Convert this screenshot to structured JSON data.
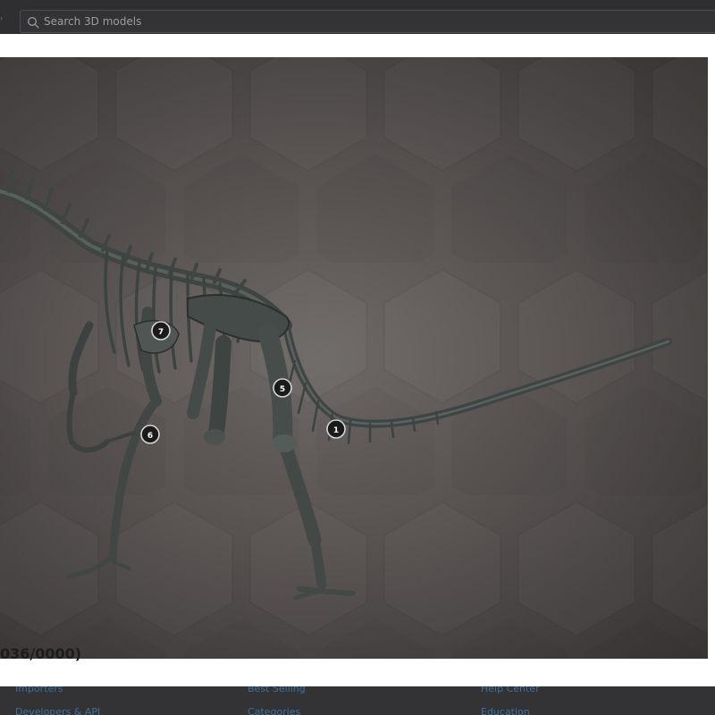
{
  "header": {
    "search": {
      "placeholder": "Search 3D models",
      "value": ""
    }
  },
  "viewer": {
    "hotspots": [
      {
        "label": "7"
      },
      {
        "label": "5"
      },
      {
        "label": "6"
      },
      {
        "label": "1"
      }
    ]
  },
  "caption": "036/0000)",
  "footer": {
    "links": [
      "Importers",
      "Developers & API",
      "Best Selling",
      "Categories",
      "Help Center",
      "Education"
    ]
  },
  "colors": {
    "header_bg": "#2f2f31",
    "modal_bg": "#ffffff",
    "viewer_bg": "#575250",
    "bone": "#3f4542",
    "footer_link": "#3f6f9a"
  }
}
